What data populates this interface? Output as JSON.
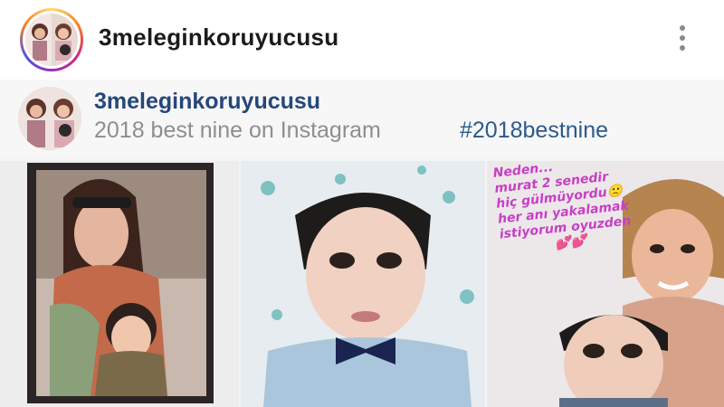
{
  "topbar": {
    "username": "3meleginkoruyucusu",
    "avatar_icon": "profile-avatar",
    "menu_icon": "more-vertical-icon"
  },
  "post_screenshot": {
    "username": "3meleginkoruyucusu",
    "caption": "2018 best nine on Instagram",
    "hashtag": "#2018bestnine",
    "tiles": [
      {
        "description_icon": "framed-photo-mother-and-son"
      },
      {
        "description_icon": "boy-with-bowtie-photo"
      },
      {
        "overlay_lines": [
          "Neden...",
          "murat 2 senedir",
          "hiç gülmüyordu🙁",
          "her anı yakalamak",
          "istiyorum oyuzden"
        ],
        "hearts": "💕💕"
      }
    ]
  },
  "colors": {
    "username": "#1b1b1b",
    "link_blue": "#25477a",
    "hashtag_blue": "#2c5a8c",
    "caption_gray": "#8e8e8e",
    "overlay_pink": "#c83fc4"
  }
}
